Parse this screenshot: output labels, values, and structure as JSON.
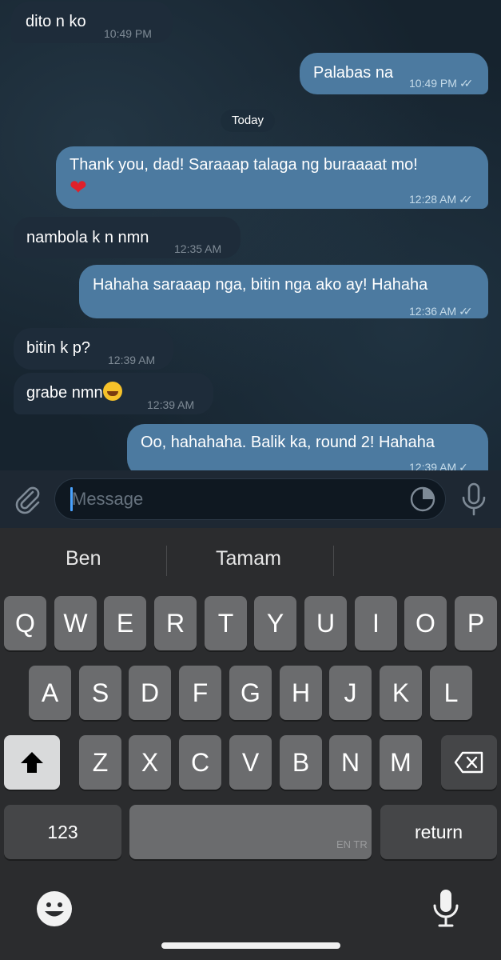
{
  "messages": [
    {
      "dir": "in",
      "text": "dito n ko",
      "time": "10:49 PM"
    },
    {
      "dir": "out",
      "text": "Palabas na",
      "time": "10:49 PM",
      "status": "read"
    },
    {
      "dir": "out",
      "text": "Thank you, dad! Saraaap talaga ng buraaaat mo!",
      "time": "12:28 AM",
      "status": "read"
    },
    {
      "dir": "in",
      "text": "nambola k n nmn",
      "time": "12:35 AM"
    },
    {
      "dir": "out",
      "text": "Hahaha saraaap nga, bitin nga ako ay! Hahaha",
      "time": "12:36 AM",
      "status": "read"
    },
    {
      "dir": "in",
      "text": "bitin k p?",
      "time": "12:39 AM"
    },
    {
      "dir": "in",
      "text": "grabe nmn",
      "time": "12:39 AM"
    },
    {
      "dir": "out",
      "text": "Oo, hahahaha. Balik ka, round 2! Hahaha",
      "time": "12:39 AM",
      "status": "sent"
    }
  ],
  "date_separator": "Today",
  "input": {
    "placeholder": "Message"
  },
  "suggestions": [
    "Ben",
    "Tamam"
  ],
  "keys": {
    "row1": [
      "Q",
      "W",
      "E",
      "R",
      "T",
      "Y",
      "U",
      "I",
      "O",
      "P"
    ],
    "row2": [
      "A",
      "S",
      "D",
      "F",
      "G",
      "H",
      "J",
      "K",
      "L"
    ],
    "row3": [
      "Z",
      "X",
      "C",
      "V",
      "B",
      "N",
      "M"
    ],
    "numbers_label": "123",
    "return_label": "return",
    "language_label": "EN TR"
  },
  "icons": {
    "attach": "paperclip-icon",
    "sticker": "sticker-icon",
    "voice": "microphone-icon",
    "shift": "shift-arrow-icon",
    "backspace": "backspace-icon",
    "emoji": "emoji-icon",
    "dictation": "microphone-icon"
  },
  "colors": {
    "incoming_bubble": "#1e2c3a",
    "outgoing_bubble": "#4c7aa0",
    "accent": "#4aa3ff"
  }
}
